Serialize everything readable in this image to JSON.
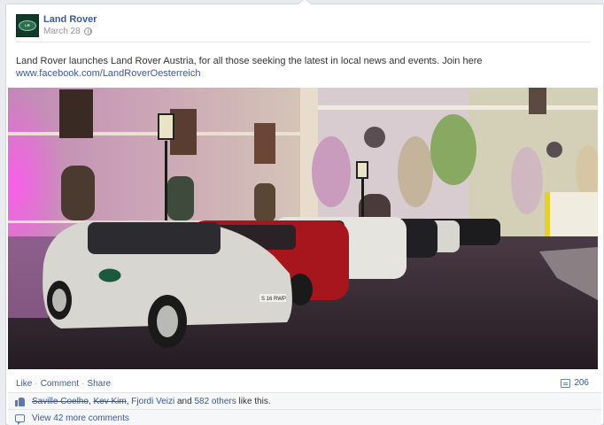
{
  "post": {
    "page_name": "Land Rover",
    "avatar_logo_text": "LAND ROVER",
    "date": "March 28",
    "privacy_icon": "globe-icon",
    "message": "Land Rover launches Land Rover Austria, for all those seeking the latest in local news and events. Join here",
    "link": "www.facebook.com/LandRoverOesterreich"
  },
  "photo": {
    "plate_text": "S 16 RWP"
  },
  "actions": {
    "like": "Like",
    "sep": "·",
    "comment": "Comment",
    "share": "Share",
    "share_count": "206",
    "share_icon": "share-icon"
  },
  "likes": {
    "icon": "like-icon",
    "name1": "Saville Coelho",
    "comma1": ",",
    "name2": "Kev Kim",
    "comma2": ",",
    "name3": "Fjordi Veizi",
    "and": "and",
    "others": "582 others",
    "suffix": "like this."
  },
  "comments": {
    "icon": "comment-icon",
    "view_more": "View 42 more comments"
  },
  "colors": {
    "link": "#3b5998",
    "lights": "#d56bd6"
  }
}
